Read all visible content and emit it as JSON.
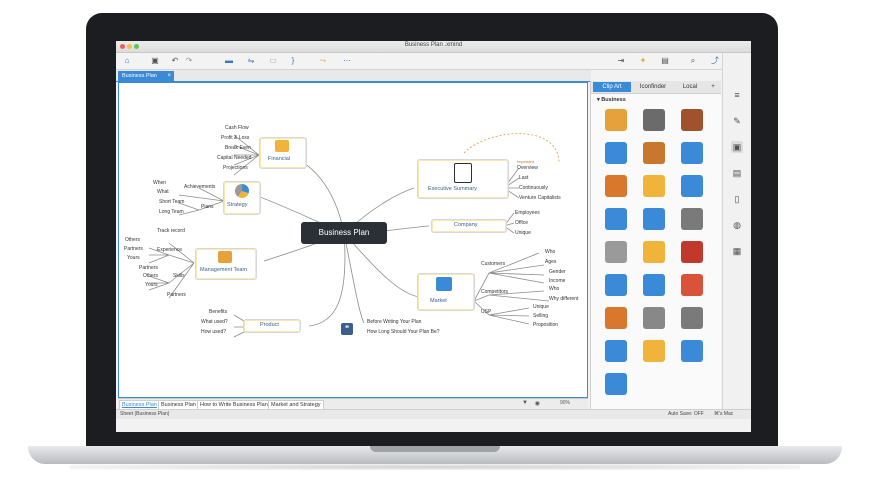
{
  "window": {
    "title": "Business Plan .xmind"
  },
  "document_tab": {
    "label": "Business Plan",
    "close_symbol": "×"
  },
  "central_topic": "Business Plan",
  "branches": {
    "financial": {
      "label": "Financial",
      "children": [
        "Cash Flow",
        "Profit & Loss",
        "Break Even",
        "Capital Needed",
        "Projections"
      ]
    },
    "strategy": {
      "label": "Strategy",
      "children": [
        "When",
        "What",
        "Achievements",
        "Short Team",
        "Long Team",
        "Plans"
      ]
    },
    "management": {
      "label": "Management Team",
      "children": [
        "Track record",
        "Others",
        "Partners",
        "Yours",
        "Experience",
        "Partners",
        "Others",
        "Yours",
        "Skills",
        "Partners"
      ]
    },
    "product": {
      "label": "Product",
      "children": [
        "Benefits",
        "What used?",
        "How used?"
      ]
    },
    "executive": {
      "label": "Executive Summary",
      "children": [
        "Overview",
        "Last",
        "Continuously",
        "Venture Capitalists"
      ],
      "callout": "Important"
    },
    "company": {
      "label": "Company",
      "children": [
        "Employees",
        "Office",
        "Unique"
      ]
    },
    "market": {
      "label": "Market",
      "children": [
        "Customers",
        "Who",
        "Ages",
        "Gender",
        "Income",
        "Competitors",
        "Who",
        "Why different",
        "USP",
        "Unique",
        "Selling",
        "Proposition"
      ]
    },
    "notes": {
      "children": [
        "Before Writing Your Plan",
        "How Long Should Your Plan Be?"
      ]
    }
  },
  "sheet_tabs": [
    "Business Plan",
    "Business Plan",
    "How to Write Business Plan",
    "Market and Strategy"
  ],
  "zoom_level": "90%",
  "status": {
    "left": "Sheet (Business Plan)",
    "autosave": "Auto Save: OFF",
    "user": "⌘'s Mac"
  },
  "panel": {
    "tabs": [
      "Clip Art",
      "Iconfinder",
      "Local"
    ],
    "section": "Business",
    "clipart": [
      {
        "name": "scales-icon",
        "color": "#e7a13a"
      },
      {
        "name": "briefcase-icon",
        "color": "#6b6b6b"
      },
      {
        "name": "calculator-icon",
        "color": "#a0522d"
      },
      {
        "name": "chat-icon",
        "color": "#3a8ad8"
      },
      {
        "name": "coffee-icon",
        "color": "#c9772c"
      },
      {
        "name": "id-card-icon",
        "color": "#3a8ad8"
      },
      {
        "name": "woman-icon",
        "color": "#d9782c"
      },
      {
        "name": "ticket-icon",
        "color": "#f0b43a"
      },
      {
        "name": "search-doc-icon",
        "color": "#3a8ad8"
      },
      {
        "name": "folder-icon",
        "color": "#3a8ad8"
      },
      {
        "name": "globe-icon",
        "color": "#3a8ad8"
      },
      {
        "name": "inbox-icon",
        "color": "#7a7a7a"
      },
      {
        "name": "layout-icon",
        "color": "#9a9a9a"
      },
      {
        "name": "pencil-icon",
        "color": "#f0b43a"
      },
      {
        "name": "presentation-icon",
        "color": "#c0392b"
      },
      {
        "name": "printer-icon",
        "color": "#3a8ad8"
      },
      {
        "name": "magnifier-icon",
        "color": "#3a8ad8"
      },
      {
        "name": "target-icon",
        "color": "#d9533a"
      },
      {
        "name": "people-icon",
        "color": "#d9782c"
      },
      {
        "name": "clock-icon",
        "color": "#888888"
      },
      {
        "name": "notepad-icon",
        "color": "#7a7a7a"
      },
      {
        "name": "chart-up-icon",
        "color": "#3a8ad8"
      },
      {
        "name": "coin-icon",
        "color": "#f0b43a"
      },
      {
        "name": "microphone-icon",
        "color": "#3a8ad8"
      },
      {
        "name": "calendar-icon",
        "color": "#3a8ad8"
      }
    ]
  }
}
